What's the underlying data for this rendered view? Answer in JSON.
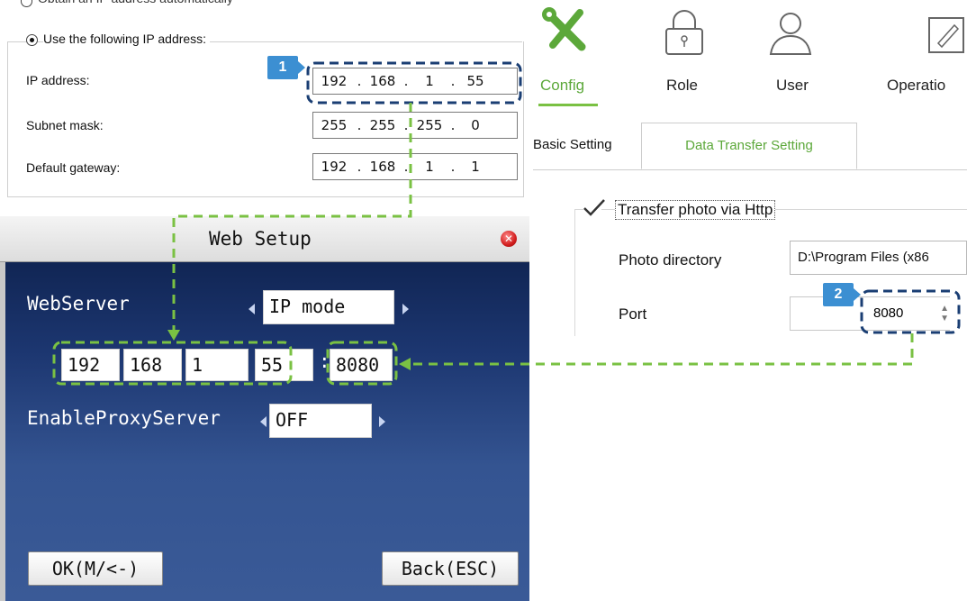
{
  "ip_config": {
    "option_auto": "Obtain an IP address automatically",
    "option_manual": "Use the following IP address:",
    "ip_label": "IP address:",
    "ip_value": [
      "192",
      "168",
      "1",
      "55"
    ],
    "subnet_label": "Subnet mask:",
    "subnet_value": [
      "255",
      "255",
      "255",
      "0"
    ],
    "gateway_label": "Default gateway:",
    "gateway_value": [
      "192",
      "168",
      "1",
      "1"
    ]
  },
  "device_web_setup": {
    "title": "Web Setup",
    "webserver_label": "WebServer",
    "webserver_mode": "IP mode",
    "ip_octets": [
      "192",
      "168",
      "1",
      "55"
    ],
    "port_separator": ":",
    "port": "8080",
    "proxy_label": "EnableProxyServer",
    "proxy_value": "OFF",
    "ok_button": "OK(M/<-)",
    "back_button": "Back(ESC)"
  },
  "software": {
    "toolbar": [
      {
        "label": "Config",
        "icon": "tools-icon"
      },
      {
        "label": "Role",
        "icon": "lock-icon"
      },
      {
        "label": "User",
        "icon": "user-icon"
      },
      {
        "label": "Operatio",
        "icon": "edit-icon"
      }
    ],
    "tabs": [
      "Basic Setting",
      "Data Transfer Setting"
    ],
    "active_tab": "Data Transfer Setting",
    "transfer_photo_label": "Transfer photo via Http",
    "transfer_photo_checked": true,
    "photo_directory_label": "Photo directory",
    "photo_directory_value": "D:\\Program Files (x86",
    "port_label": "Port",
    "port_value": "8080"
  },
  "callouts": [
    "1",
    "2"
  ],
  "colors": {
    "accent_green": "#7ac143",
    "dashed_blue": "#1a3e73",
    "callout_blue": "#3c8fd2"
  }
}
